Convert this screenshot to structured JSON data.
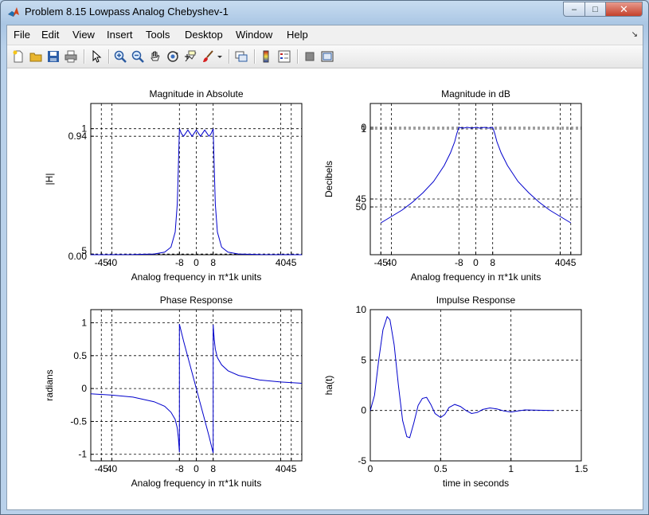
{
  "window": {
    "title": "Problem 8.15 Lowpass Analog Chebyshev-1",
    "controls": {
      "minimize": "–",
      "maximize": "□",
      "close": "✕"
    }
  },
  "menu": {
    "items": [
      "File",
      "Edit",
      "View",
      "Insert",
      "Tools",
      "Desktop",
      "Window",
      "Help"
    ],
    "overflow_icon": "dock-arrow-icon"
  },
  "toolbar": {
    "icons": [
      "new-figure-icon",
      "open-icon",
      "save-icon",
      "print-icon",
      "pointer-icon",
      "zoom-in-icon",
      "zoom-out-icon",
      "pan-hand-icon",
      "rotate-3d-icon",
      "data-cursor-icon",
      "brush-icon",
      "link-plot-icon",
      "colorbar-icon",
      "legend-icon",
      "hide-plot-tools-icon",
      "show-plot-tools-icon"
    ]
  },
  "colors": {
    "curve": "#0000cc",
    "grid": "#000000",
    "axis_bg": "#ffffff",
    "figure_bg": "#ffffff"
  },
  "chart_data": [
    {
      "type": "line",
      "title": "Magnitude in Absolute",
      "xlabel": "Analog frequency in π*1k units",
      "ylabel": "|H|",
      "xlim": [
        -50,
        50
      ],
      "ylim": [
        0,
        1.2
      ],
      "xticks": [
        -45,
        -40,
        -8,
        0,
        8,
        40,
        45
      ],
      "xticklabels": [
        "-45",
        "40",
        "-8",
        "0",
        "8",
        "40",
        "45"
      ],
      "yticks": [
        0,
        0.005,
        0.94,
        1
      ],
      "yticklabels": [
        "0.00",
        "5",
        "0.94",
        "1"
      ],
      "series": [
        {
          "x": [
            -50,
            -40,
            -30,
            -20,
            -15,
            -12,
            -10,
            -9,
            -8.5,
            -8,
            -7,
            -6,
            -4,
            -2,
            0,
            2,
            4,
            6,
            7,
            8,
            8.5,
            9,
            10,
            12,
            15,
            20,
            30,
            40,
            50
          ],
          "y": [
            0.0003,
            0.0006,
            0.0015,
            0.006,
            0.02,
            0.06,
            0.18,
            0.4,
            0.7,
            1.0,
            0.96,
            0.94,
            0.99,
            0.94,
            0.99,
            0.94,
            0.99,
            0.94,
            0.96,
            1.0,
            0.7,
            0.4,
            0.18,
            0.06,
            0.02,
            0.006,
            0.0015,
            0.0006,
            0.0003
          ]
        }
      ]
    },
    {
      "type": "line",
      "title": "Magnitude in dB",
      "xlabel": "Analog frequency in π*1k units",
      "ylabel": "Decibels",
      "xlim": [
        -50,
        50
      ],
      "ylim": [
        -80,
        15
      ],
      "yreversed_labels": true,
      "xticks": [
        -45,
        -40,
        -8,
        0,
        8,
        40,
        45
      ],
      "xticklabels": [
        "-45",
        "40",
        "-8",
        "0",
        "8",
        "40",
        "45"
      ],
      "yticks": [
        0,
        -1,
        -45,
        -50
      ],
      "yticklabels": [
        "0",
        "1",
        "45",
        "50"
      ],
      "series": [
        {
          "x": [
            -45,
            -40,
            -35,
            -30,
            -25,
            -20,
            -15,
            -12,
            -10,
            -9,
            -8,
            -6,
            -4,
            -2,
            0,
            2,
            4,
            6,
            8,
            9,
            10,
            12,
            15,
            20,
            25,
            30,
            35,
            40,
            45
          ],
          "y": [
            -60,
            -56,
            -52,
            -47,
            -41,
            -34,
            -24,
            -16,
            -9,
            -4,
            0,
            -0.5,
            0,
            -0.5,
            0,
            -0.5,
            0,
            -0.5,
            0,
            -4,
            -9,
            -16,
            -24,
            -34,
            -41,
            -47,
            -52,
            -56,
            -60
          ]
        }
      ]
    },
    {
      "type": "line",
      "title": "Phase Response",
      "xlabel": "Analog frequency in π*1k nuits",
      "ylabel": "radians",
      "xlim": [
        -50,
        50
      ],
      "ylim": [
        -1.1,
        1.2
      ],
      "xticks": [
        -45,
        -40,
        -8,
        0,
        8,
        40,
        45
      ],
      "xticklabels": [
        "-45",
        "40",
        "-8",
        "0",
        "8",
        "40",
        "45"
      ],
      "yticks": [
        -1,
        -0.5,
        0,
        0.5,
        1
      ],
      "yticklabels": [
        "-1",
        "-0.5",
        "0",
        "0.5",
        "1"
      ],
      "series": [
        {
          "x": [
            -50,
            -40,
            -30,
            -20,
            -15,
            -12,
            -10,
            -9,
            -8.5,
            -8,
            -8,
            -6,
            -4,
            -2,
            0,
            2,
            4,
            6,
            8,
            8,
            8.5,
            9,
            10,
            12,
            15,
            20,
            30,
            40,
            50
          ],
          "y": [
            -0.08,
            -0.1,
            -0.13,
            -0.2,
            -0.27,
            -0.36,
            -0.47,
            -0.6,
            -0.75,
            -0.97,
            0.98,
            0.72,
            0.48,
            0.24,
            0,
            -0.24,
            -0.48,
            -0.72,
            -0.98,
            0.97,
            0.75,
            0.6,
            0.47,
            0.36,
            0.27,
            0.2,
            0.13,
            0.1,
            0.08
          ]
        }
      ]
    },
    {
      "type": "line",
      "title": "Impulse Response",
      "xlabel": "time in seconds",
      "ylabel": "ha(t)",
      "xlim": [
        0,
        1.5
      ],
      "ylim": [
        -5,
        10
      ],
      "xticks": [
        0,
        0.5,
        1,
        1.5
      ],
      "xticklabels": [
        "0",
        "0.5",
        "1",
        "1.5"
      ],
      "yticks": [
        -5,
        0,
        5,
        10
      ],
      "yticklabels": [
        "-5",
        "0",
        "5",
        "10"
      ],
      "series": [
        {
          "x": [
            0,
            0.03,
            0.06,
            0.09,
            0.12,
            0.14,
            0.17,
            0.2,
            0.23,
            0.26,
            0.28,
            0.31,
            0.34,
            0.37,
            0.4,
            0.43,
            0.46,
            0.5,
            0.53,
            0.56,
            0.6,
            0.64,
            0.68,
            0.72,
            0.76,
            0.8,
            0.85,
            0.9,
            0.95,
            1.0,
            1.05,
            1.1,
            1.2,
            1.3
          ],
          "y": [
            0,
            1.5,
            5,
            8,
            9.3,
            9,
            6.5,
            2.5,
            -1,
            -2.6,
            -2.7,
            -1.2,
            0.5,
            1.2,
            1.3,
            0.6,
            -0.3,
            -0.7,
            -0.4,
            0.3,
            0.6,
            0.4,
            0,
            -0.3,
            -0.2,
            0.1,
            0.25,
            0.15,
            -0.05,
            -0.15,
            -0.05,
            0.05,
            0.02,
            0
          ]
        }
      ]
    }
  ]
}
